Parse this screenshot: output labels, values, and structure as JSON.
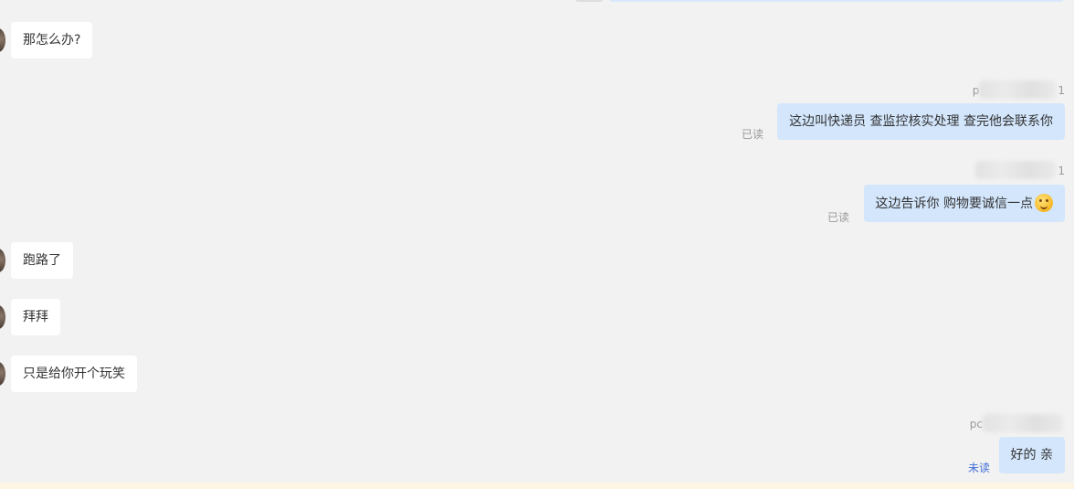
{
  "messages": [
    {
      "side": "left",
      "text": "那怎么办?"
    },
    {
      "side": "right",
      "sender_prefix": "p",
      "sender_suffix": "1",
      "text": "这边叫快递员 查监控核实处理 查完他会联系你",
      "status": "已读"
    },
    {
      "side": "right",
      "sender_prefix": "",
      "sender_suffix": "1",
      "text": "这边告诉你 购物要诚信一点",
      "emoji": "thinking-emoji-icon",
      "status": "已读"
    },
    {
      "side": "left",
      "text": "跑路了"
    },
    {
      "side": "left",
      "text": "拜拜"
    },
    {
      "side": "left",
      "text": "只是给你开个玩笑"
    },
    {
      "side": "right",
      "sender_prefix": "pc",
      "sender_suffix": "",
      "text": "好的 亲",
      "status": "未读"
    }
  ],
  "colors": {
    "background": "#f2f2f2",
    "left_bubble": "#ffffff",
    "right_bubble": "#d3e6fc",
    "read_status": "#999999",
    "unread_status": "#3f6fd8"
  }
}
